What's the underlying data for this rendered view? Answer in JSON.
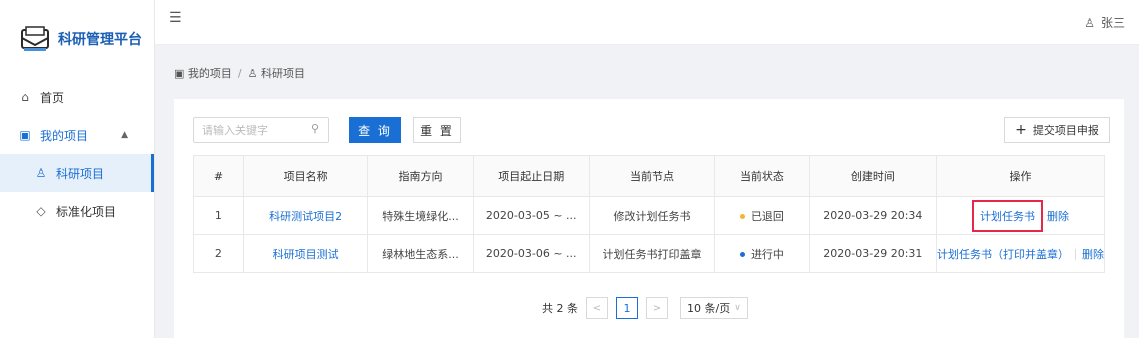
{
  "app": {
    "title": "科研管理平台"
  },
  "topbar": {
    "user_name": "张三"
  },
  "sidebar": {
    "items": [
      {
        "label": "首页",
        "icon": "home-icon"
      },
      {
        "label": "我的项目",
        "icon": "folder-icon"
      },
      {
        "label": "科研项目",
        "icon": "user-icon"
      },
      {
        "label": "标准化项目",
        "icon": "shield-icon"
      }
    ]
  },
  "breadcrumb": {
    "first": "我的项目",
    "sep": "/",
    "second": "科研项目"
  },
  "toolbar": {
    "search_placeholder": "请输入关键字",
    "query_label": "查 询",
    "reset_label": "重 置",
    "submit_label": "提交项目申报"
  },
  "table": {
    "headers": [
      "#",
      "项目名称",
      "指南方向",
      "项目起止日期",
      "当前节点",
      "当前状态",
      "创建时间",
      "操作"
    ],
    "rows": [
      {
        "index": "1",
        "name": "科研测试项目2",
        "direction": "特殊生境绿化...",
        "dates": "2020-03-05 ~ ...",
        "node": "修改计划任务书",
        "status": "已退回",
        "status_color": "#f5b62a",
        "created": "2020-03-29 20:34",
        "action_primary": "计划任务书",
        "action_delete": "删除"
      },
      {
        "index": "2",
        "name": "科研项目测试",
        "direction": "绿林地生态系...",
        "dates": "2020-03-06 ~ ...",
        "node": "计划任务书打印盖章",
        "status": "进行中",
        "status_color": "#1a6fd4",
        "created": "2020-03-29 20:31",
        "action_primary": "计划任务书（打印并盖章）",
        "action_delete": "删除"
      }
    ]
  },
  "pagination": {
    "total_text": "共 2 条",
    "current_page": "1",
    "page_size": "10 条/页"
  },
  "colors": {
    "accent": "#1a6fd4",
    "highlight": "#e5284a"
  }
}
